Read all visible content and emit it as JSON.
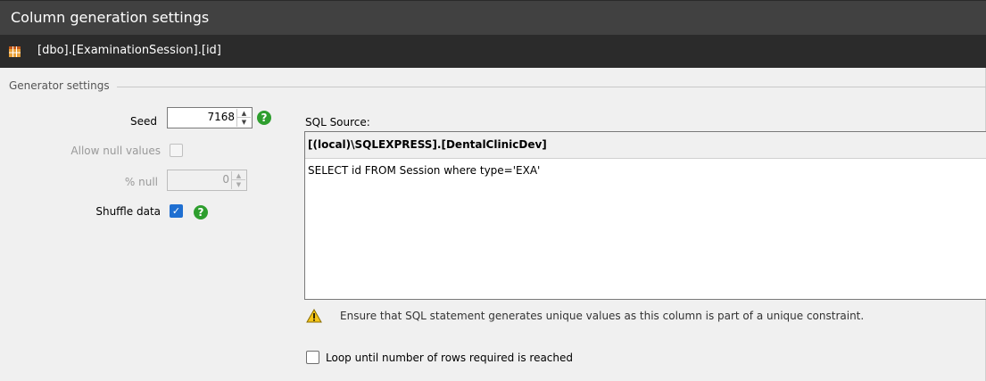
{
  "title": "Column generation settings",
  "column_path": "[dbo].[ExaminationSession].[id]",
  "column_icon": "table-column-icon",
  "generator": {
    "group_label": "Generator settings",
    "seed_label": "Seed",
    "seed_value": "7168",
    "allow_null_label": "Allow null values",
    "allow_null_checked": false,
    "null_percent_label": "% null",
    "null_percent_value": "0",
    "shuffle_label": "Shuffle data",
    "shuffle_checked": true,
    "help_icon": "question-icon"
  },
  "sql": {
    "label": "SQL Source:",
    "connection": "[(local)\\SQLEXPRESS].[DentalClinicDev]",
    "query": "SELECT id FROM Session where type='EXA'",
    "warning": "Ensure that SQL statement generates unique values as this column is part of a unique constraint.",
    "warning_icon": "warning-icon",
    "loop_label": "Loop until number of rows required is reached",
    "loop_checked": false
  },
  "colors": {
    "title_bg": "#414141",
    "subtitle_bg": "#2b2b2b",
    "help_green": "#2e9e2e",
    "checkbox_blue": "#1f6fd1",
    "warning_yellow": "#f5c518"
  }
}
